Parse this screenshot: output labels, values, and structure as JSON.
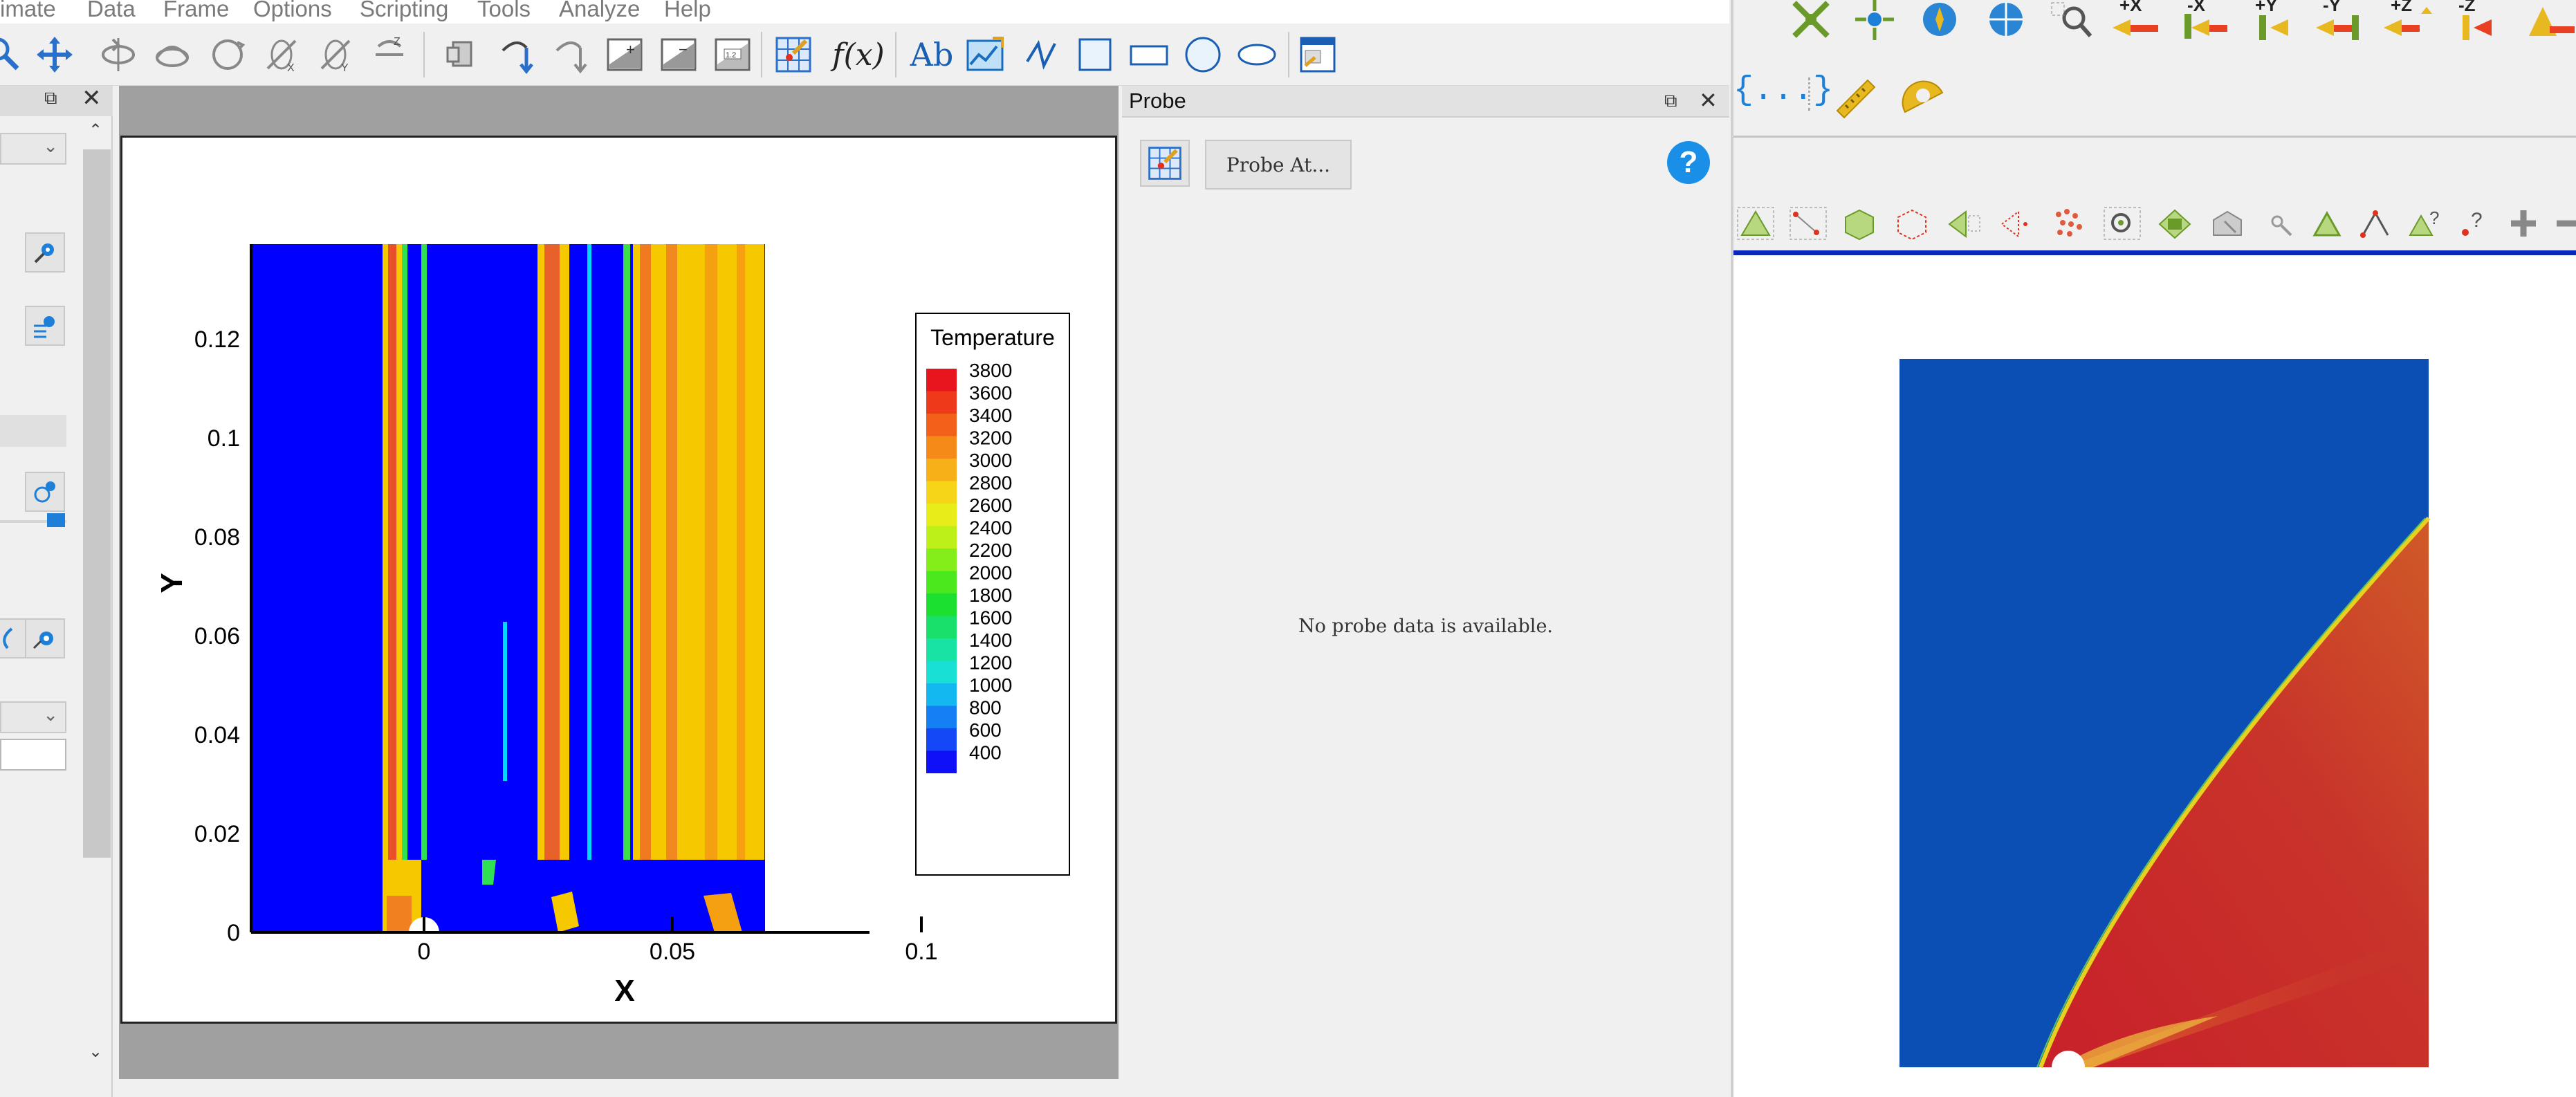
{
  "menubar": {
    "items": [
      "imate",
      "Data",
      "Frame",
      "Options",
      "Scripting",
      "Tools",
      "Analyze",
      "Help"
    ]
  },
  "toolbar": {
    "icons": [
      "zoom-icon",
      "translate-icon",
      "rotate-icon",
      "rotate-x-icon",
      "rotate-y-icon",
      "rotate-z-icon",
      "rollerball-icon",
      "probe-icon",
      "extract-icon",
      "slice-icon",
      "contour-icon",
      "streamtrace-icon",
      "data-label-icon",
      "probe-grid-icon",
      "equation-icon",
      "text-icon",
      "geometry-image-icon",
      "line-icon",
      "square-icon",
      "rectangle-icon",
      "circle-icon",
      "ellipse-icon",
      "frame-icon"
    ],
    "equation_label": "f(x)",
    "text_label": "Ab"
  },
  "probe": {
    "title": "Probe",
    "probe_at_label": "Probe At...",
    "help_label": "?",
    "message": "No probe data is available."
  },
  "plot": {
    "xlabel": "X",
    "ylabel": "Y",
    "x_ticks": [
      "0",
      "0.05",
      "0.1"
    ],
    "y_ticks": [
      "0",
      "0.02",
      "0.04",
      "0.06",
      "0.08",
      "0.1",
      "0.12"
    ],
    "legend_title": "Temperature",
    "legend_levels": [
      "3800",
      "3600",
      "3400",
      "3200",
      "3000",
      "2800",
      "2600",
      "2400",
      "2200",
      "2000",
      "1800",
      "1600",
      "1400",
      "1200",
      "1000",
      "800",
      "600",
      "400"
    ]
  },
  "right_app": {
    "camera_buttons": [
      "+X",
      "-X",
      "+Y",
      "-Y",
      "+Z",
      "-Z"
    ],
    "brace_label": "{...}"
  },
  "colors": {
    "cold": "#0000ff",
    "hot": "#e8281e",
    "render_bg": "#0b4fb5",
    "render_hot": "#c8342a"
  }
}
